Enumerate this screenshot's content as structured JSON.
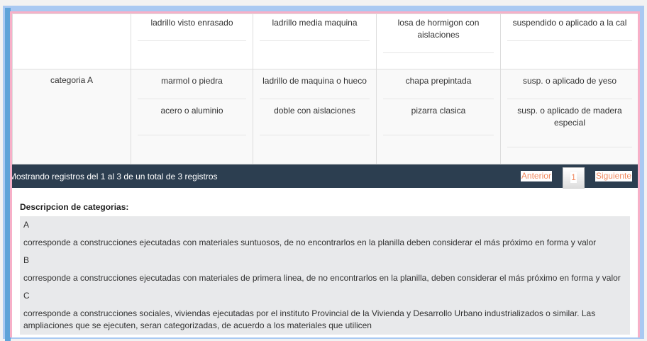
{
  "table": {
    "row1": {
      "category": "",
      "cells": [
        [
          "ladrillo visto enrasado"
        ],
        [
          "ladrillo media maquina"
        ],
        [
          "losa de hormigon con aislaciones"
        ],
        [
          "suspendido o aplicado a la cal"
        ]
      ]
    },
    "row2": {
      "category": "categoria A",
      "cells": [
        [
          "marmol o piedra",
          "acero o aluminio"
        ],
        [
          "ladrillo de maquina o hueco",
          "doble con aislaciones"
        ],
        [
          "chapa prepintada",
          "pizarra clasica"
        ],
        [
          "susp. o aplicado de yeso",
          "susp. o aplicado de madera especial"
        ]
      ]
    }
  },
  "footer": {
    "info": "Mostrando registros del 1 al 3 de un total de 3 registros",
    "prev": "Anterior",
    "page": "1",
    "next": "Siguiente"
  },
  "description": {
    "title": "Descripcion de categorias:",
    "items": [
      {
        "label": "A",
        "text": "corresponde a construcciones ejecutadas con materiales suntuosos, de no encontrarlos en la planilla deben considerar el más próximo en forma y valor"
      },
      {
        "label": "B",
        "text": "corresponde a construcciones ejecutadas con materiales de primera linea, de no encontrarlos en la planilla, deben considerar el más próximo en forma y valor"
      },
      {
        "label": "C",
        "text": "corresponde a construcciones sociales, viviendas ejecutadas por el instituto Provincial de la Vivienda y Desarrollo Urbano industrializados o similar. Las ampliaciones que se ejecuten, seran categorizadas, de acuerdo a los materiales que utilicen"
      }
    ]
  }
}
